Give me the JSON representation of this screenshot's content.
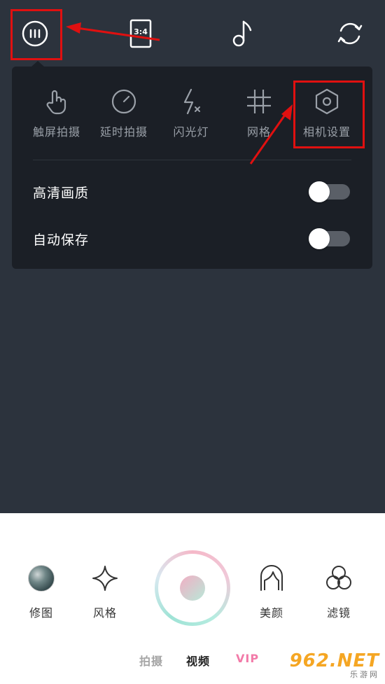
{
  "topbar": {
    "ratio_label": "3:4",
    "icons": [
      "menu-icon",
      "aspect-ratio-icon",
      "music-note-icon",
      "switch-camera-icon"
    ]
  },
  "panel": {
    "tools": [
      {
        "label": "触屏拍摄",
        "icon": "touch-hand-icon"
      },
      {
        "label": "延时拍摄",
        "icon": "timer-icon"
      },
      {
        "label": "闪光灯",
        "icon": "flash-off-icon"
      },
      {
        "label": "网格",
        "icon": "grid-icon"
      },
      {
        "label": "相机设置",
        "icon": "settings-hexagon-icon"
      }
    ],
    "settings": [
      {
        "label": "高清画质",
        "enabled": false
      },
      {
        "label": "自动保存",
        "enabled": false
      }
    ]
  },
  "bottom": {
    "items": [
      {
        "label": "修图",
        "icon": "gallery-thumbnail"
      },
      {
        "label": "风格",
        "icon": "sparkle-icon"
      },
      {
        "label": "美颜",
        "icon": "face-icon"
      },
      {
        "label": "滤镜",
        "icon": "filter-circles-icon"
      }
    ],
    "modes": [
      "拍摄",
      "视频",
      "VIP"
    ],
    "active_mode": "视频"
  },
  "watermark": {
    "main": "962.NET",
    "sub": "乐游网"
  },
  "colors": {
    "viewfinder_bg": "#2c333d",
    "panel_bg": "#1b1f26",
    "highlight": "#e01010",
    "vip": "#f27aa8",
    "watermark": "#f5a623"
  }
}
